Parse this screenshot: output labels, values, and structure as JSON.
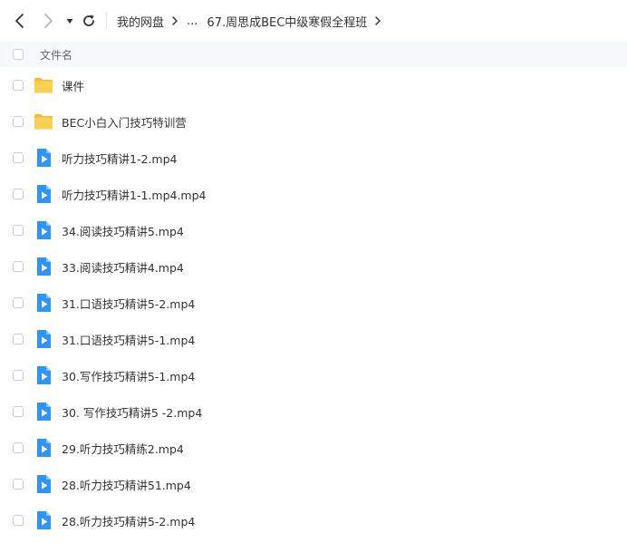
{
  "toolbar": {
    "back_icon": "chevron-left-icon",
    "forward_icon": "chevron-right-icon",
    "history_icon": "caret-down-icon",
    "refresh_icon": "refresh-icon",
    "breadcrumb": [
      "我的网盘",
      "...",
      "67.周思成BEC中级寒假全程班"
    ]
  },
  "list_header": {
    "name_label": "文件名"
  },
  "files": [
    {
      "name": "课件",
      "type": "folder"
    },
    {
      "name": "BEC小白入门技巧特训营",
      "type": "folder"
    },
    {
      "name": "听力技巧精讲1-2.mp4",
      "type": "video"
    },
    {
      "name": "听力技巧精讲1-1.mp4.mp4",
      "type": "video"
    },
    {
      "name": "34.阅读技巧精讲5.mp4",
      "type": "video"
    },
    {
      "name": "33.阅读技巧精讲4.mp4",
      "type": "video"
    },
    {
      "name": "31.口语技巧精讲5-2.mp4",
      "type": "video"
    },
    {
      "name": "31.口语技巧精讲5-1.mp4",
      "type": "video"
    },
    {
      "name": "30.写作技巧精讲5-1.mp4",
      "type": "video"
    },
    {
      "name": "30. 写作技巧精讲5 -2.mp4",
      "type": "video"
    },
    {
      "name": "29.听力技巧精练2.mp4",
      "type": "video"
    },
    {
      "name": "28.听力技巧精讲51.mp4",
      "type": "video"
    },
    {
      "name": "28.听力技巧精讲5-2.mp4",
      "type": "video"
    }
  ],
  "colors": {
    "folder": "#f9c94a",
    "video": "#2f95f5",
    "header_bg": "#f7f8fa"
  }
}
